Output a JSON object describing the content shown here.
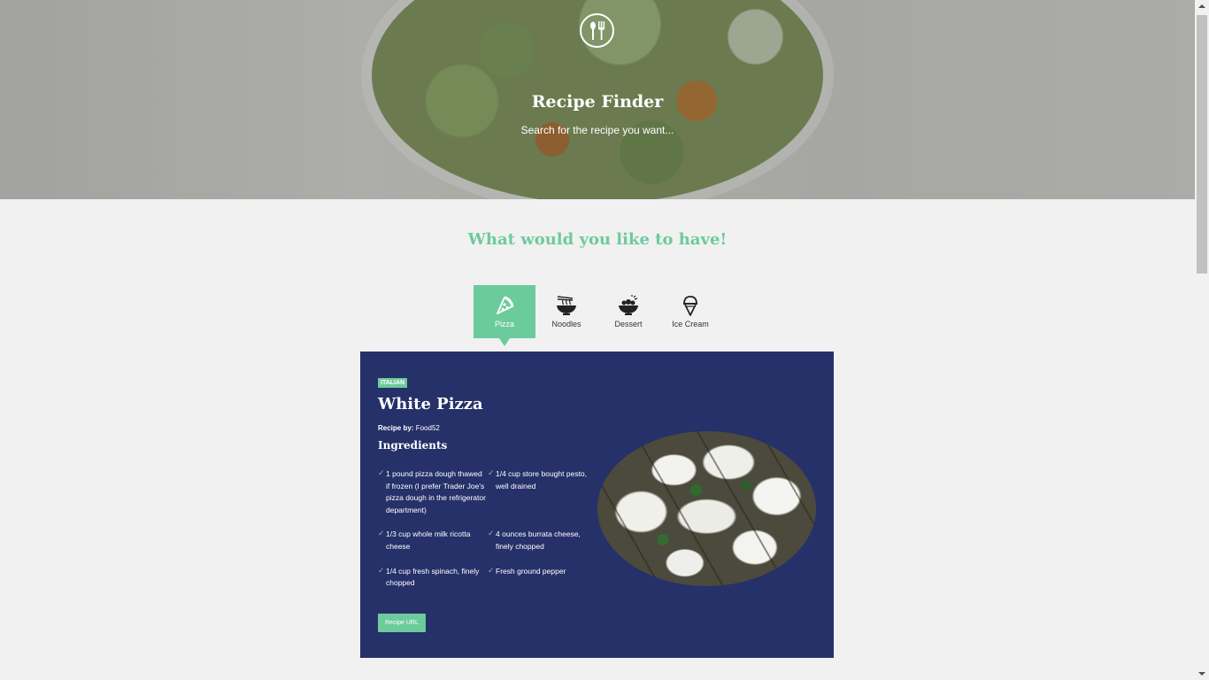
{
  "hero": {
    "logo_icon": "spoon-fork-icon",
    "title": "Recipe Finder",
    "subtitle": "Search for the recipe you want..."
  },
  "section": {
    "title": "What would you like to have!"
  },
  "tabs": [
    {
      "label": "Pizza",
      "icon": "pizza-icon",
      "active": true
    },
    {
      "label": "Noodles",
      "icon": "noodles-icon",
      "active": false
    },
    {
      "label": "Dessert",
      "icon": "dessert-icon",
      "active": false
    },
    {
      "label": "Ice Cream",
      "icon": "ice-cream-icon",
      "active": false
    }
  ],
  "recipe": {
    "cuisine": "ITALIAN",
    "title": "White Pizza",
    "by_label": "Recipe by:",
    "by_value": "Food52",
    "ingredients_title": "Ingredients",
    "ingredients": [
      "1 pound pizza dough thawed if frozen (I prefer Trader Joe's pizza dough in the refrigerator department)",
      "1/4 cup store bought pesto, well drained",
      "1/3 cup whole milk ricotta cheese",
      "4 ounces burrata cheese, finely chopped",
      "1/4 cup fresh spinach, finely chopped",
      "Fresh ground pepper"
    ],
    "button_label": "Recipe URL"
  },
  "colors": {
    "accent": "#6ccb9b",
    "card_bg": "#263069",
    "page_bg": "#f1f1f1"
  }
}
